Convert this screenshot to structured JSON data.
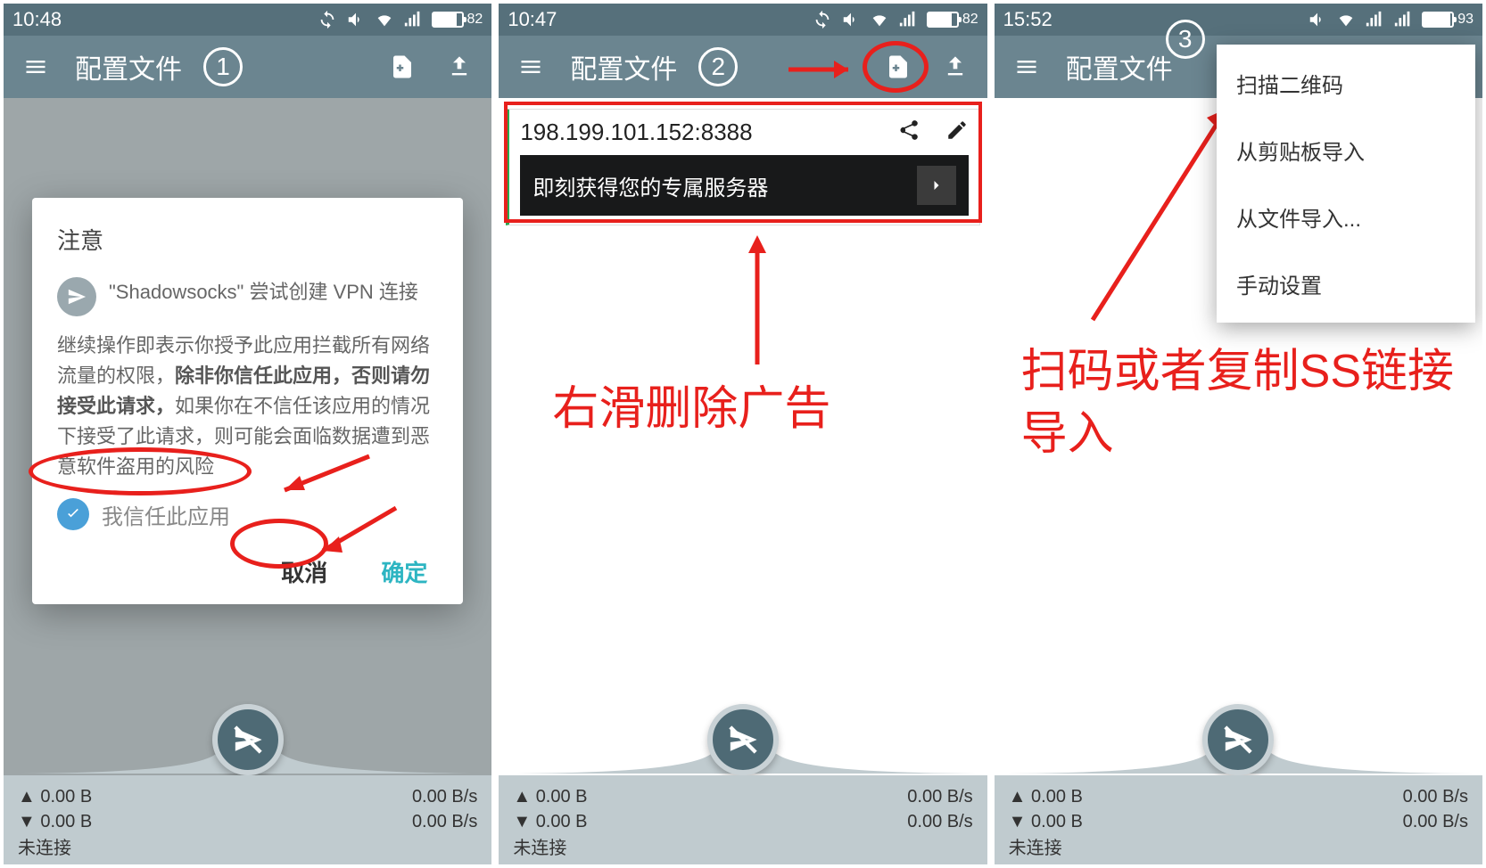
{
  "screens": {
    "s1": {
      "statusbar": {
        "time": "10:48",
        "battery": "82"
      },
      "appbar": {
        "title": "配置文件",
        "step": "1"
      },
      "dialog": {
        "title": "注意",
        "line1": "\"Shadowsocks\" 尝试创建 VPN 连接",
        "body_pre": "继续操作即表示你授予此应用拦截所有网络流量的权限，",
        "body_bold": "除非你信任此应用，否则请勿接受此请求，",
        "body_post": "如果你在不信任该应用的情况下接受了此请求，则可能会面临数据遭到恶意软件盗用的风险",
        "trust_label": "我信任此应用",
        "cancel": "取消",
        "ok": "确定"
      },
      "footer": {
        "up_bytes": "0.00 B",
        "down_bytes": "0.00 B",
        "up_rate": "0.00 B/s",
        "down_rate": "0.00 B/s",
        "status": "未连接"
      }
    },
    "s2": {
      "statusbar": {
        "time": "10:47",
        "battery": "82"
      },
      "appbar": {
        "title": "配置文件",
        "step": "2"
      },
      "server": {
        "address": "198.199.101.152:8388",
        "ad_text": "即刻获得您的专属服务器"
      },
      "annotation": "右滑删除广告",
      "footer": {
        "up_bytes": "0.00 B",
        "down_bytes": "0.00 B",
        "up_rate": "0.00 B/s",
        "down_rate": "0.00 B/s",
        "status": "未连接"
      }
    },
    "s3": {
      "statusbar": {
        "time": "15:52",
        "battery": "93"
      },
      "appbar": {
        "title": "配置文件",
        "step": "3"
      },
      "menu": {
        "item1": "扫描二维码",
        "item2": "从剪贴板导入",
        "item3": "从文件导入...",
        "item4": "手动设置"
      },
      "annotation": "扫码或者复制SS链接导入",
      "footer": {
        "up_bytes": "0.00 B",
        "down_bytes": "0.00 B",
        "up_rate": "0.00 B/s",
        "down_rate": "0.00 B/s",
        "status": "未连接"
      }
    }
  }
}
